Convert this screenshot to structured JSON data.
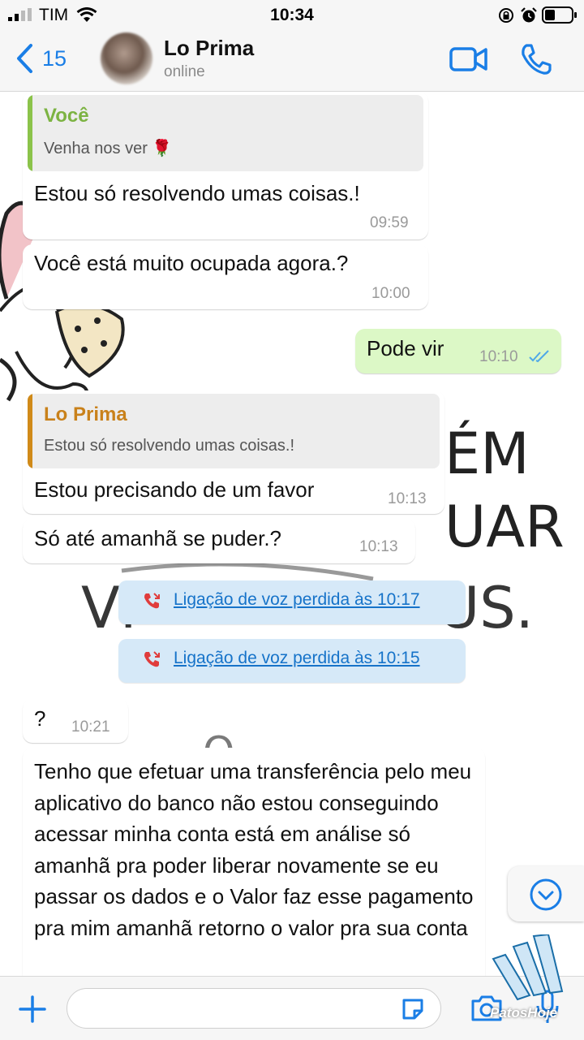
{
  "status_bar": {
    "carrier": "TIM",
    "time": "10:34"
  },
  "header": {
    "back_count": "15",
    "contact_name": "Lo Prima",
    "contact_status": "online"
  },
  "messages": [
    {
      "direction": "in",
      "quote_name": "Você",
      "quote_text": "Venha nos ver 🌹",
      "text": "Estou só resolvendo umas coisas.!",
      "time": "09:59"
    },
    {
      "direction": "in",
      "text": "Você está muito ocupada agora.?",
      "time": "10:00"
    },
    {
      "direction": "out",
      "text": "Pode vir",
      "time": "10:10",
      "status": "read"
    },
    {
      "direction": "in",
      "quote_name": "Lo Prima",
      "quote_text": "Estou só resolvendo umas coisas.!",
      "text": "Estou precisando de um favor",
      "time": "10:13"
    },
    {
      "direction": "in",
      "text": "Só até amanhã se puder.?",
      "time": "10:13"
    },
    {
      "type": "missed_call",
      "text": "Ligação de voz perdida às 10:17"
    },
    {
      "type": "missed_call",
      "text": "Ligação de voz perdida às 10:15"
    },
    {
      "direction": "in",
      "text": "?",
      "time": "10:21"
    },
    {
      "direction": "in",
      "text": "Tenho que efetuar uma transferência pelo meu aplicativo do banco não estou conseguindo acessar minha conta está em análise só amanhã pra poder liberar novamente se eu passar os dados e o Valor faz esse pagamento pra mim amanhã retorno o valor pra sua conta"
    }
  ],
  "watermark": "PatosHoje",
  "colors": {
    "accent": "#1a7ee6",
    "outgoing_bubble": "#dcf8c6",
    "quote_you": "#8bc34a",
    "quote_contact": "#d08a19",
    "missed_call_bg": "#d6e9f8",
    "missed_call_icon": "#e03c3c",
    "read_ticks": "#4fa8e8"
  },
  "icons": [
    "signal-icon",
    "wifi-icon",
    "lock-rotation-icon",
    "alarm-icon",
    "battery-icon",
    "back-chevron-icon",
    "video-call-icon",
    "phone-icon",
    "double-check-icon",
    "missed-call-icon",
    "chevron-down-icon",
    "plus-icon",
    "sticker-icon",
    "camera-icon",
    "microphone-icon"
  ]
}
